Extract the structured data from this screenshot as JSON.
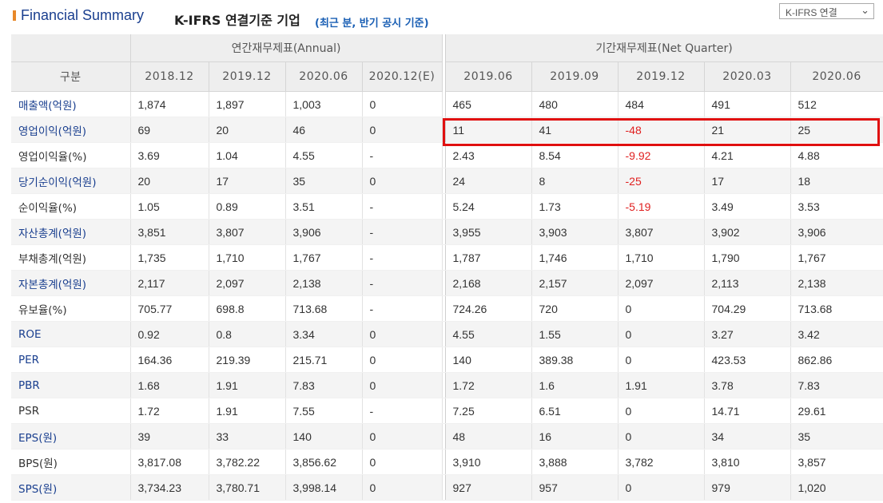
{
  "header": {
    "title": "Financial Summary",
    "basis": "K-IFRS 연결기준 기업",
    "basis_note": "(최근 분, 반기 공시 기준)",
    "select_value": "K-IFRS 연결",
    "accent_color": "#e8892a",
    "title_color": "#1a3f8f"
  },
  "table": {
    "category_header": "구분",
    "annual_header": "연간재무제표(Annual)",
    "quarter_header": "기간재무제표(Net Quarter)",
    "annual_columns": [
      "2018.12",
      "2019.12",
      "2020.06",
      "2020.12(E)"
    ],
    "quarter_columns": [
      "2019.06",
      "2019.09",
      "2019.12",
      "2020.03",
      "2020.06"
    ],
    "rows": [
      {
        "label": "매출액(억원)",
        "link": true,
        "annual": [
          "1,874",
          "1,897",
          "1,003",
          "0"
        ],
        "quarter": [
          "465",
          "480",
          "484",
          "491",
          "512"
        ]
      },
      {
        "label": "영업이익(억원)",
        "link": true,
        "annual": [
          "69",
          "20",
          "46",
          "0"
        ],
        "quarter": [
          "11",
          "41",
          "-48",
          "21",
          "25"
        ]
      },
      {
        "label": "영업이익율(%)",
        "link": false,
        "annual": [
          "3.69",
          "1.04",
          "4.55",
          "-"
        ],
        "quarter": [
          "2.43",
          "8.54",
          "-9.92",
          "4.21",
          "4.88"
        ]
      },
      {
        "label": "당기순이익(억원)",
        "link": true,
        "annual": [
          "20",
          "17",
          "35",
          "0"
        ],
        "quarter": [
          "24",
          "8",
          "-25",
          "17",
          "18"
        ]
      },
      {
        "label": "순이익율(%)",
        "link": false,
        "annual": [
          "1.05",
          "0.89",
          "3.51",
          "-"
        ],
        "quarter": [
          "5.24",
          "1.73",
          "-5.19",
          "3.49",
          "3.53"
        ]
      },
      {
        "label": "자산총계(억원)",
        "link": true,
        "annual": [
          "3,851",
          "3,807",
          "3,906",
          "-"
        ],
        "quarter": [
          "3,955",
          "3,903",
          "3,807",
          "3,902",
          "3,906"
        ]
      },
      {
        "label": "부채총계(억원)",
        "link": false,
        "annual": [
          "1,735",
          "1,710",
          "1,767",
          "-"
        ],
        "quarter": [
          "1,787",
          "1,746",
          "1,710",
          "1,790",
          "1,767"
        ]
      },
      {
        "label": "자본총계(억원)",
        "link": true,
        "annual": [
          "2,117",
          "2,097",
          "2,138",
          "-"
        ],
        "quarter": [
          "2,168",
          "2,157",
          "2,097",
          "2,113",
          "2,138"
        ]
      },
      {
        "label": "유보율(%)",
        "link": false,
        "annual": [
          "705.77",
          "698.8",
          "713.68",
          "-"
        ],
        "quarter": [
          "724.26",
          "720",
          "0",
          "704.29",
          "713.68"
        ]
      },
      {
        "label": "ROE",
        "link": true,
        "annual": [
          "0.92",
          "0.8",
          "3.34",
          "0"
        ],
        "quarter": [
          "4.55",
          "1.55",
          "0",
          "3.27",
          "3.42"
        ]
      },
      {
        "label": "PER",
        "link": true,
        "annual": [
          "164.36",
          "219.39",
          "215.71",
          "0"
        ],
        "quarter": [
          "140",
          "389.38",
          "0",
          "423.53",
          "862.86"
        ]
      },
      {
        "label": "PBR",
        "link": true,
        "annual": [
          "1.68",
          "1.91",
          "7.83",
          "0"
        ],
        "quarter": [
          "1.72",
          "1.6",
          "1.91",
          "3.78",
          "7.83"
        ]
      },
      {
        "label": "PSR",
        "link": false,
        "annual": [
          "1.72",
          "1.91",
          "7.55",
          "-"
        ],
        "quarter": [
          "7.25",
          "6.51",
          "0",
          "14.71",
          "29.61"
        ]
      },
      {
        "label": "EPS(원)",
        "link": true,
        "annual": [
          "39",
          "33",
          "140",
          "0"
        ],
        "quarter": [
          "48",
          "16",
          "0",
          "34",
          "35"
        ]
      },
      {
        "label": "BPS(원)",
        "link": false,
        "annual": [
          "3,817.08",
          "3,782.22",
          "3,856.62",
          "0"
        ],
        "quarter": [
          "3,910",
          "3,888",
          "3,782",
          "3,810",
          "3,857"
        ]
      },
      {
        "label": "SPS(원)",
        "link": true,
        "annual": [
          "3,734.23",
          "3,780.71",
          "3,998.14",
          "0"
        ],
        "quarter": [
          "927",
          "957",
          "0",
          "979",
          "1,020"
        ]
      }
    ],
    "negative_color": "#e02020",
    "highlight_color": "#e01010",
    "link_color": "#1a3f8f"
  }
}
